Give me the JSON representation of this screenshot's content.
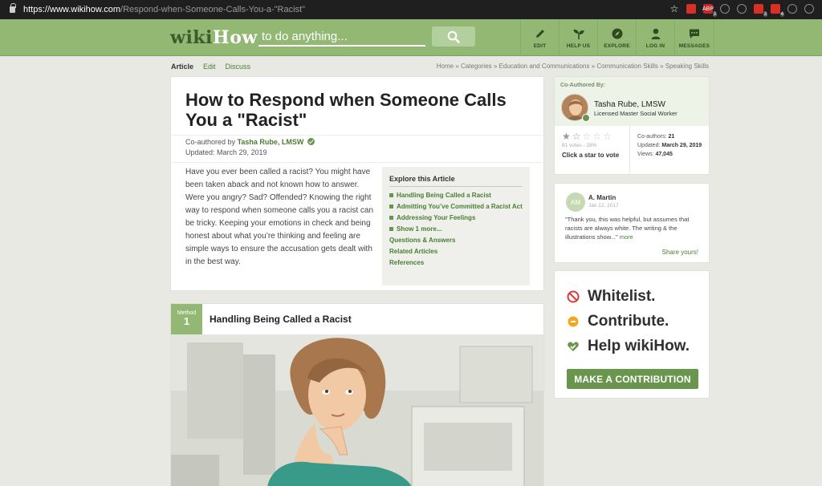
{
  "browser": {
    "url_host": "https://www.wikihow.com",
    "url_path": "/Respond-when-Someone-Calls-You-a-\"Racist\"",
    "extensions": [
      {
        "icon": "star-bookmark-icon",
        "color": "#1f1f1f",
        "label": "",
        "count": ""
      },
      {
        "icon": "extension-red-icon",
        "color": "#d93025",
        "label": "",
        "count": ""
      },
      {
        "icon": "abp-icon",
        "color": "#c62828",
        "label": "ABP",
        "count": "3"
      },
      {
        "icon": "pocket-icon",
        "color": "#1f1f1f",
        "label": "",
        "count": ""
      },
      {
        "icon": "vue-icon",
        "color": "#1f1f1f",
        "label": "",
        "count": ""
      },
      {
        "icon": "extension-badge-icon",
        "color": "#d93025",
        "label": "",
        "count": "3"
      },
      {
        "icon": "lastpass-icon",
        "color": "#d93025",
        "label": "",
        "count": "4"
      },
      {
        "icon": "camera-icon",
        "color": "#1f1f1f",
        "label": "",
        "count": ""
      },
      {
        "icon": "document-icon",
        "color": "#1f1f1f",
        "label": "",
        "count": ""
      }
    ]
  },
  "header": {
    "logo_part1": "wiki",
    "logo_part2": "How",
    "search_placeholder": "to do anything...",
    "nav": [
      {
        "icon": "pencil-edit-icon",
        "label": "EDIT"
      },
      {
        "icon": "sprout-help-icon",
        "label": "HELP US"
      },
      {
        "icon": "compass-explore-icon",
        "label": "EXPLORE"
      },
      {
        "icon": "user-login-icon",
        "label": "LOG IN"
      },
      {
        "icon": "chat-messages-icon",
        "label": "MESSAGES"
      }
    ]
  },
  "subnav": {
    "tabs": [
      "Article",
      "Edit",
      "Discuss"
    ],
    "breadcrumbs": "Home » Categories » Education and Communications » Communication Skills » Speaking Skills"
  },
  "article": {
    "title": "How to Respond when Someone Calls You a \"Racist\"",
    "coauthored_prefix": "Co-authored by",
    "author": "Tasha Rube, LMSW",
    "updated": "Updated: March 29, 2019",
    "intro": "Have you ever been called a racist? You might have been taken aback and not known how to answer. Were you angry? Sad? Offended? Knowing the right way to respond when someone calls you a racist can be tricky. Keeping your emotions in check and being honest about what you’re thinking and feeling are simple ways to ensure the accusation gets dealt with in the best way.",
    "explore_title": "Explore this Article",
    "explore_items": [
      "Handling Being Called a Racist",
      "Admitting You’ve Committed a Racist Act",
      "Addressing Your Feelings",
      "Show 1 more..."
    ],
    "explore_links": [
      "Questions & Answers",
      "Related Articles",
      "References"
    ]
  },
  "method": {
    "badge_label": "Method",
    "badge_number": "1",
    "title": "Handling Being Called a Racist"
  },
  "sidebar": {
    "coauthored_head": "Co-Authored By:",
    "expert_name": "Tasha Rube, LMSW",
    "expert_title": "Licensed Master Social Worker",
    "rating": 1.5,
    "votes": "81 votes - 28%",
    "vote_cta": "Click a star to vote",
    "coauthors_label": "Co-authors:",
    "coauthors": "21",
    "updated_label": "Updated:",
    "updated": "March 29, 2019",
    "views_label": "Views:",
    "views": "47,045",
    "review": {
      "initials": "AM",
      "name": "A. Martin",
      "date": "Jan 12, 2017",
      "text": "\"Thank you, this was helpful, but assumes that racists are always white. The writing & the illustrations show...\"",
      "more": "more",
      "share": "Share yours!"
    },
    "promo": {
      "lines": [
        "Whitelist.",
        "Contribute.",
        "Help wikiHow."
      ],
      "button": "MAKE A CONTRIBUTION"
    }
  },
  "colors": {
    "brand_green": "#93b874",
    "dark_green": "#4a7d33",
    "button_green": "#69954d"
  }
}
